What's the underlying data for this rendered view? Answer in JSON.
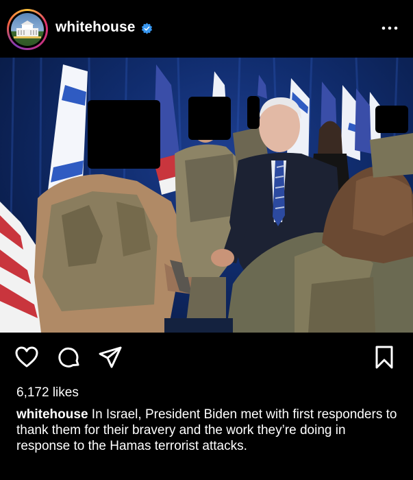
{
  "post": {
    "username": "whitehouse",
    "likes": "6,172 likes",
    "caption_user": "whitehouse",
    "caption_text": "In Israel, President Biden met with first responders to thank them for their bravery and the work they’re doing in response to the Hamas terrorist attacks."
  },
  "icons": {
    "verified": "verified-badge",
    "more": "more-options",
    "like": "heart-outline",
    "comment": "speech-bubble",
    "share": "paper-plane",
    "save": "bookmark-outline"
  },
  "colors": {
    "background": "#000000",
    "verified": "#3897f0",
    "text": "#ffffff"
  }
}
